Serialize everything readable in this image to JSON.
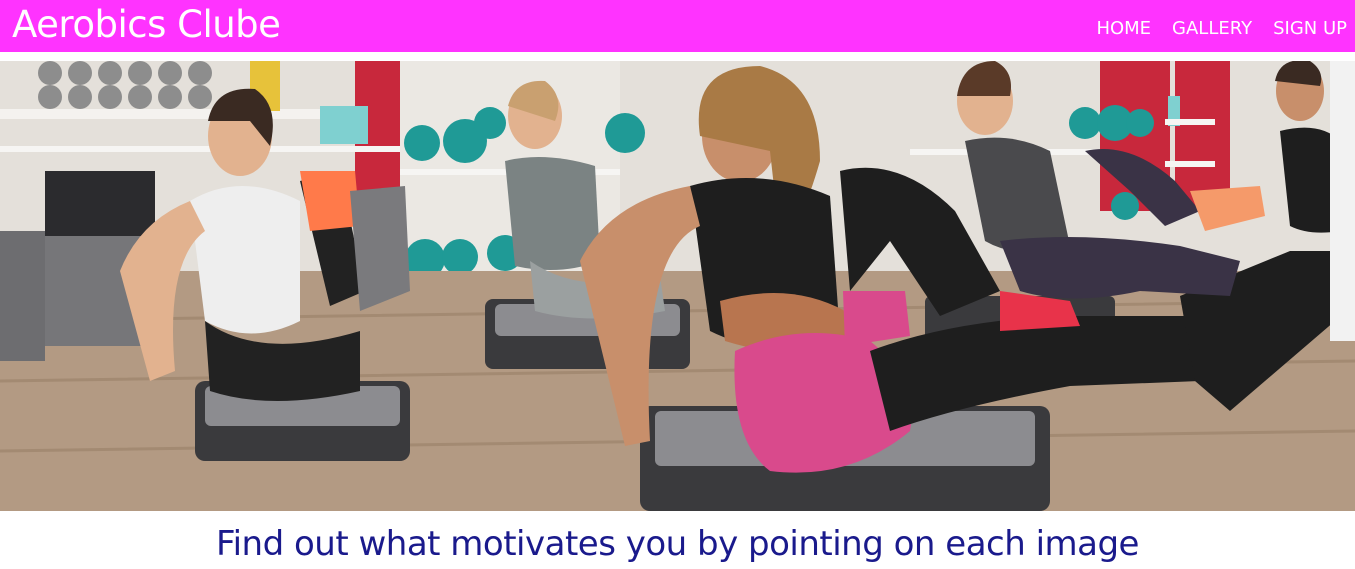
{
  "header": {
    "brand": "Aerobics Clube",
    "nav": [
      {
        "label": "HOME"
      },
      {
        "label": "GALLERY"
      },
      {
        "label": "SIGN UP"
      }
    ],
    "bg_color": "#ff33ff"
  },
  "hero": {
    "alt": "Women doing aerobics on step platforms in a gym"
  },
  "main": {
    "heading": "Find out what motivates you by pointing on each image",
    "heading_color": "#1a1a8c"
  }
}
